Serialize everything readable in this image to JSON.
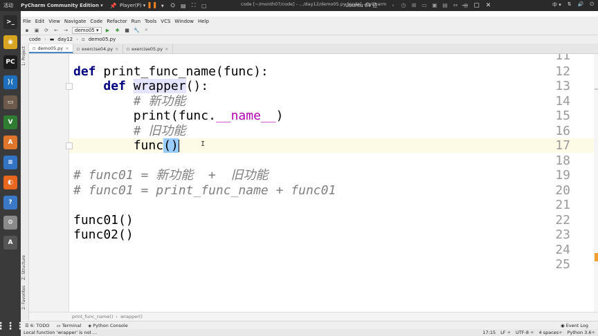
{
  "topbar": {
    "activities": "活动",
    "app_menu": "PyCharm Community Edition ▾",
    "player": "Player(P) ▾",
    "window_title": "code [~/month07/code] - .../day12/demo05.py [code] - PyCharm",
    "vm_title": "Ubuntu 64 位",
    "ime": "中 ▾",
    "sys_icons": [
      "network-icon",
      "volume-icon",
      "power-icon"
    ]
  },
  "menubar": [
    "File",
    "Edit",
    "View",
    "Navigate",
    "Code",
    "Refactor",
    "Run",
    "Tools",
    "VCS",
    "Window",
    "Help"
  ],
  "toolbar": {
    "run_config": "demo05 ▾"
  },
  "breadcrumb": [
    "code",
    "day12",
    "demo05.py"
  ],
  "tabs": [
    {
      "label": "demo05.py",
      "active": true
    },
    {
      "label": "exercise04.py",
      "active": false
    },
    {
      "label": "exercise05.py",
      "active": false
    }
  ],
  "side_labels": {
    "project": "1: Project",
    "structure": "Z: Structure",
    "favorites": "2: Favorites"
  },
  "editor": {
    "lines": [
      {
        "n": "11"
      },
      {
        "n": "12"
      },
      {
        "n": "13"
      },
      {
        "n": "14"
      },
      {
        "n": "15"
      },
      {
        "n": "16"
      },
      {
        "n": "17"
      },
      {
        "n": "18"
      },
      {
        "n": "19"
      },
      {
        "n": "20"
      },
      {
        "n": "21"
      },
      {
        "n": "22"
      },
      {
        "n": "23"
      },
      {
        "n": "24"
      },
      {
        "n": "25"
      }
    ],
    "code": {
      "l12_kw": "def",
      "l12_rest": " print_func_name(func):",
      "l13_kw": "def",
      "l13_name": "wrapper",
      "l13_rest": "():",
      "l14": "# 新功能",
      "l15_a": "print(func.",
      "l15_dunder": "__name__",
      "l15_b": ")",
      "l16": "# 旧功能",
      "l17_a": "func",
      "l17_paren": "()",
      "l19": "# func01 = 新功能  +  旧功能",
      "l20": "# func01 = print_func_name + func01",
      "l22": "func01()",
      "l23": "func02()"
    }
  },
  "nav_crumb": [
    "print_func_name()",
    "wrapper()"
  ],
  "tool_windows": {
    "todo": "6: TODO",
    "terminal": "Terminal",
    "console": "Python Console",
    "event_log": "Event Log"
  },
  "status": {
    "message": "Local function 'wrapper' is not ...",
    "position": "17:15",
    "line_sep": "LF ÷",
    "encoding": "UTF-8 ÷",
    "indent": "4 spaces÷",
    "interpreter": "Python 3.6÷"
  },
  "dock_apps": [
    {
      "icon": "terminal-icon",
      "color": "#2b2b2b",
      "glyph": ">_"
    },
    {
      "icon": "chrome-icon",
      "color": "#d9a520",
      "glyph": "◉"
    },
    {
      "icon": "pycharm-icon",
      "color": "#1c1c1c",
      "glyph": "PC"
    },
    {
      "icon": "vscode-icon",
      "color": "#1f6fbf",
      "glyph": "⟩⟨"
    },
    {
      "icon": "files-icon",
      "color": "#6d5a4a",
      "glyph": "▭"
    },
    {
      "icon": "vim-icon",
      "color": "#2e7d32",
      "glyph": "V"
    },
    {
      "icon": "software-center-icon",
      "color": "#e0762c",
      "glyph": "A"
    },
    {
      "icon": "document-icon",
      "color": "#3373c4",
      "glyph": "≡"
    },
    {
      "icon": "firefox-icon",
      "color": "#e8661d",
      "glyph": "◐"
    },
    {
      "icon": "help-icon",
      "color": "#3a78c8",
      "glyph": "?"
    },
    {
      "icon": "settings-icon",
      "color": "#8a8a8a",
      "glyph": "⚙"
    },
    {
      "icon": "updater-icon",
      "color": "#555555",
      "glyph": "A"
    }
  ]
}
